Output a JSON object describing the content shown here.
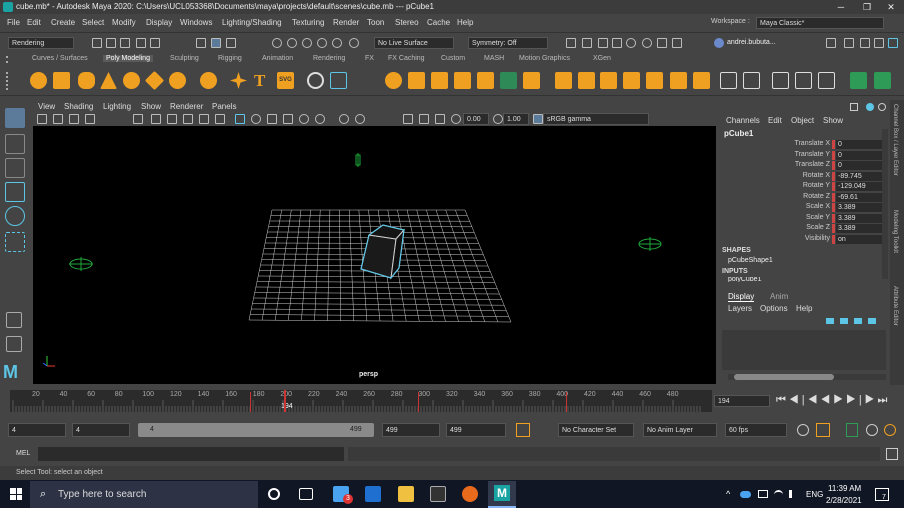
{
  "window": {
    "title": "cube.mb* - Autodesk Maya 2020: C:\\Users\\UCL053368\\Documents\\maya\\projects\\default\\scenes\\cube.mb  ---  pCube1",
    "minimize": "─",
    "maximize": "❐",
    "close": "✕"
  },
  "menu": [
    "File",
    "Edit",
    "Create",
    "Select",
    "Modify",
    "Display",
    "Windows",
    "Lighting/Shading",
    "Texturing",
    "Render",
    "Toon",
    "Stereo",
    "Cache",
    "Help"
  ],
  "workspace": {
    "label": "Workspace :",
    "value": "Maya Classic*"
  },
  "statusline": {
    "menuset": "Rendering",
    "live_surface": "No Live Surface",
    "symmetry": "Symmetry: Off",
    "user": "andrei.bubuta..."
  },
  "shelf_tabs": [
    "Curves / Surfaces",
    "Poly Modeling",
    "Sculpting",
    "Rigging",
    "Animation",
    "Rendering",
    "FX",
    "FX Caching",
    "Custom",
    "MASH",
    "Motion Graphics",
    "XGen"
  ],
  "active_shelf_tab": "Poly Modeling",
  "shelf_icons": [
    "sphere-icon",
    "cube-icon",
    "cylinder-icon",
    "cone-icon",
    "torus-icon",
    "plane-icon",
    "disc-icon",
    "platonic-icon",
    "star-icon",
    "text-icon",
    "svg-icon",
    "combine-icon",
    "separate-icon",
    "smooth-icon",
    "bevel-icon",
    "bridge-icon",
    "extrude-icon",
    "multicut-icon",
    "target-weld-icon",
    "mirror-icon",
    "uv-editor-icon",
    "settings-icon"
  ],
  "shelf_svg_label": "SVG",
  "shelf_text_label": "T",
  "viewport": {
    "menus": [
      "View",
      "Shading",
      "Lighting",
      "Show",
      "Renderer",
      "Panels"
    ],
    "near_clip": "0.00",
    "far_clip": "1.00",
    "color_space": "sRGB gamma",
    "camera_label": "persp"
  },
  "channel_box": {
    "menus": [
      "Channels",
      "Edit",
      "Object",
      "Show"
    ],
    "object": "pCube1",
    "attributes": [
      {
        "name": "Translate X",
        "value": "0"
      },
      {
        "name": "Translate Y",
        "value": "0"
      },
      {
        "name": "Translate Z",
        "value": "0"
      },
      {
        "name": "Rotate X",
        "value": "-89.745"
      },
      {
        "name": "Rotate Y",
        "value": "-129.049"
      },
      {
        "name": "Rotate Z",
        "value": "-69.61"
      },
      {
        "name": "Scale X",
        "value": "3.389"
      },
      {
        "name": "Scale Y",
        "value": "3.389"
      },
      {
        "name": "Scale Z",
        "value": "3.389"
      },
      {
        "name": "Visibility",
        "value": "on"
      }
    ],
    "shapes_header": "SHAPES",
    "shape": "pCubeShape1",
    "inputs_header": "INPUTS",
    "input": "polyCube1"
  },
  "side_tabs": [
    "Channel Box / Layer Editor",
    "Modeling Toolkit",
    "Attribute Editor"
  ],
  "layers": {
    "tabs": [
      "Display",
      "Anim"
    ],
    "menus": [
      "Layers",
      "Options",
      "Help"
    ]
  },
  "timeline": {
    "ticks": [
      "20",
      "40",
      "60",
      "80",
      "100",
      "120",
      "140",
      "160",
      "180",
      "200",
      "220",
      "240",
      "260",
      "280",
      "300",
      "320",
      "340",
      "360",
      "380",
      "400",
      "420",
      "440",
      "460",
      "480"
    ],
    "current_frame": "194",
    "current_marker": "194"
  },
  "range": {
    "start": "4",
    "playback_start": "4",
    "slider_start": "4",
    "slider_end": "499",
    "playback_end": "499",
    "end": "499",
    "character_set": "No Character Set",
    "anim_layer": "No Anim Layer",
    "fps": "60 fps"
  },
  "mel": {
    "label": "MEL"
  },
  "help": "Select Tool: select an object",
  "taskbar": {
    "search_placeholder": "Type here to search",
    "time": "11:39 AM",
    "date": "2/28/2021",
    "language": "ENG",
    "notification_count": "7",
    "mail_badge": "3"
  },
  "colors": {
    "accent": "#5dc5e5",
    "shelf_orange": "#f0a020",
    "cube": "#d0d0d0",
    "grid": "#cfcfcf"
  }
}
